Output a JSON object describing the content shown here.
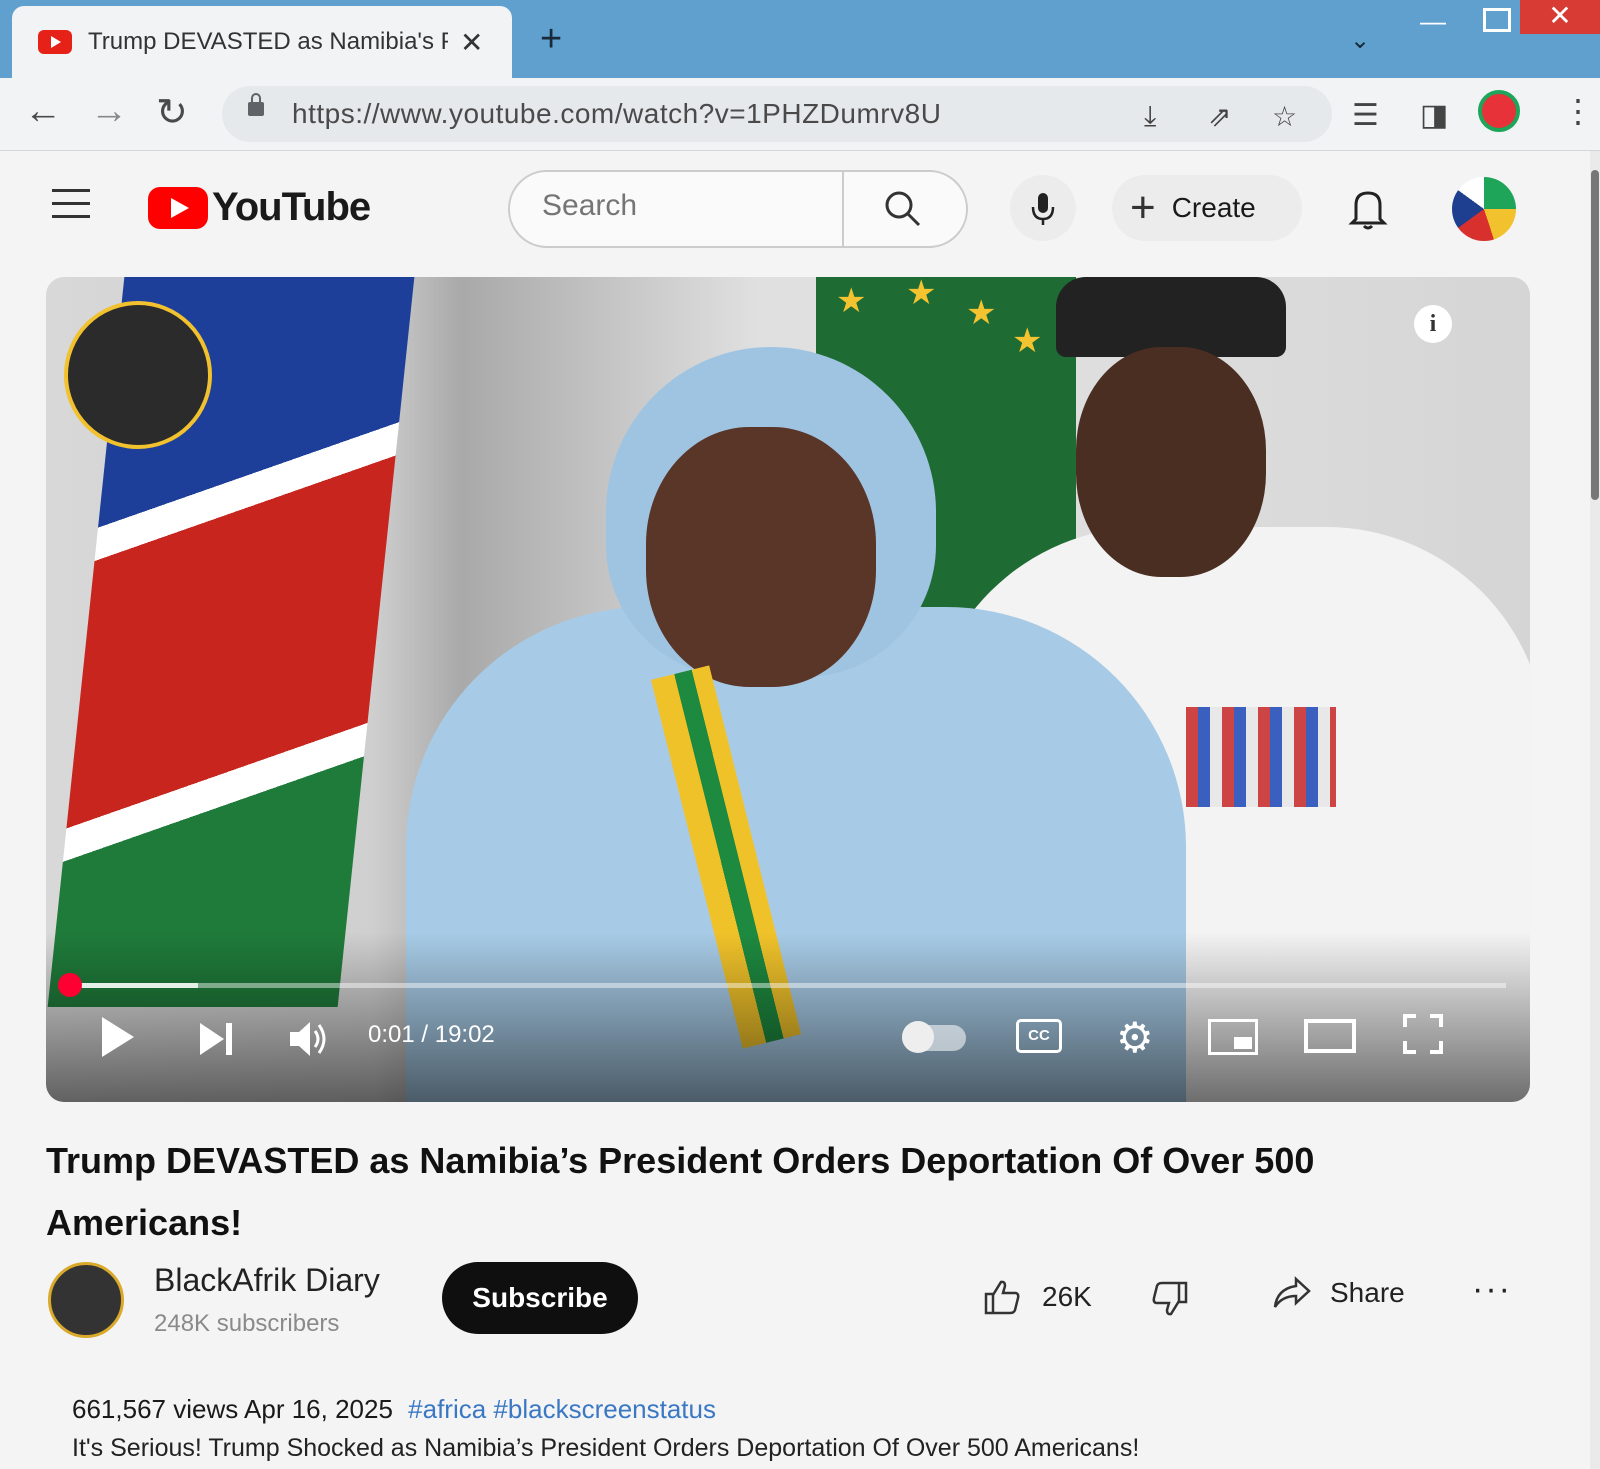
{
  "browser": {
    "tab_title": "Trump DEVASTED as Namibia's P",
    "url": "https://www.youtube.com/watch?v=1PHZDumrv8U"
  },
  "youtube": {
    "logo_text": "YouTube",
    "search_placeholder": "Search",
    "create_label": "Create"
  },
  "player": {
    "time": "0:01 / 19:02",
    "progress": 0.0009,
    "cc_label": "CC",
    "info_label": "i"
  },
  "video": {
    "title": "Trump DEVASTED as Namibia’s President Orders Deportation Of Over 500 Americans!",
    "channel": "BlackAfrik Diary",
    "subscribers": "248K subscribers",
    "subscribe_label": "Subscribe",
    "likes": "26K",
    "share_label": "Share",
    "more_label": "···",
    "views": "661,567 views",
    "date": "Apr 16, 2025",
    "hashtags": "#africa #blackscreenstatus",
    "description": "It's Serious! Trump Shocked as Namibia’s President Orders Deportation Of Over 500 Americans!"
  },
  "colors": {
    "brand_red": "#ff0000",
    "progress_red": "#ff0033",
    "hashtag_blue": "#3a78c4",
    "tabstrip_blue": "#5fa0cf"
  },
  "icons": [
    "back-icon",
    "forward-icon",
    "reload-icon",
    "lock-icon",
    "install-icon",
    "share-page-icon",
    "star-icon",
    "reading-list-icon",
    "side-panel-icon",
    "menu-icon",
    "search-icon",
    "mic-icon",
    "plus-icon",
    "bell-icon",
    "play-icon",
    "next-icon",
    "volume-icon",
    "settings-icon",
    "miniplayer-icon",
    "theater-icon",
    "fullscreen-icon",
    "thumbs-up-icon",
    "thumbs-down-icon",
    "share-icon"
  ]
}
